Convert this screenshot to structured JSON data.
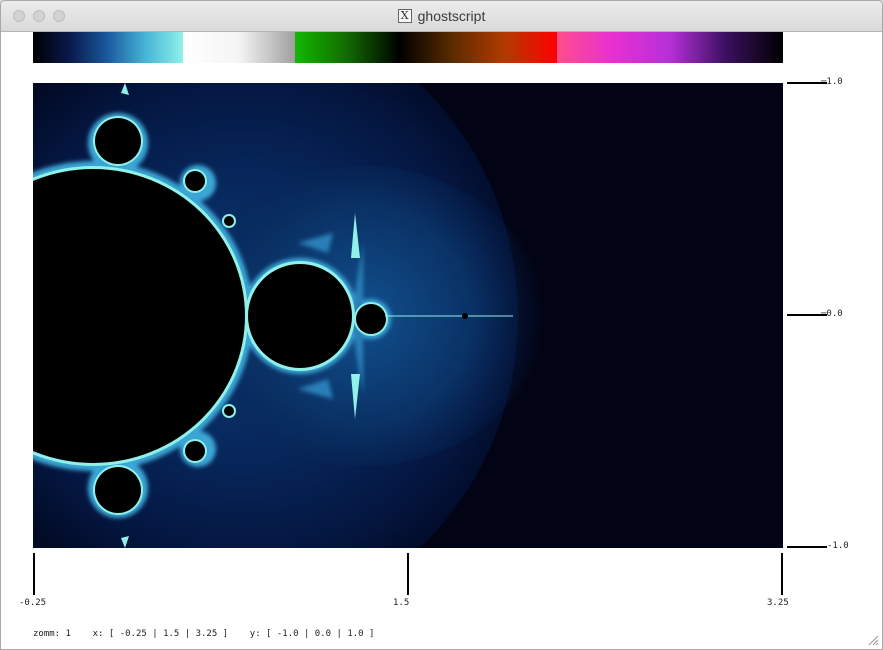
{
  "window": {
    "title": "ghostscript"
  },
  "colorbar": {
    "segments": [
      {
        "name": "segment-navy-cyan",
        "width": 150,
        "gradient": [
          "#000000",
          "#0a1a4e",
          "#1c5aa0",
          "#47b4d8",
          "#8ff1e8"
        ]
      },
      {
        "name": "segment-white-gray",
        "width": 112,
        "gradient": [
          "#ffffff",
          "#f4f4f4",
          "#a0a0a0"
        ]
      },
      {
        "name": "segment-green-brown-red",
        "width": 262,
        "gradient": [
          "#13b800",
          "#116a00",
          "#000000",
          "#5a2b00",
          "#b23a00",
          "#ff0000"
        ]
      },
      {
        "name": "segment-pink-purple",
        "width": 226,
        "gradient": [
          "#ff4e8a",
          "#e82fd2",
          "#b530d8",
          "#3a0f60",
          "#000000"
        ]
      }
    ]
  },
  "axes": {
    "x_ticks": [
      "-0.25",
      "1.5",
      "3.25"
    ],
    "y_ticks": [
      "1.0",
      "0.0",
      "-1.0"
    ]
  },
  "status": {
    "zoom": "zomm: 1",
    "x": "x: [ -0.25 | 1.5 | 3.25 ]",
    "y": "y: [ -1.0 | 0.0 | 1.0 ]"
  },
  "colors": {
    "background_dark": "#020416",
    "halo_blue": "#0a2a5a",
    "edge_cyan": "#8ff1e8",
    "set_black": "#000000"
  }
}
